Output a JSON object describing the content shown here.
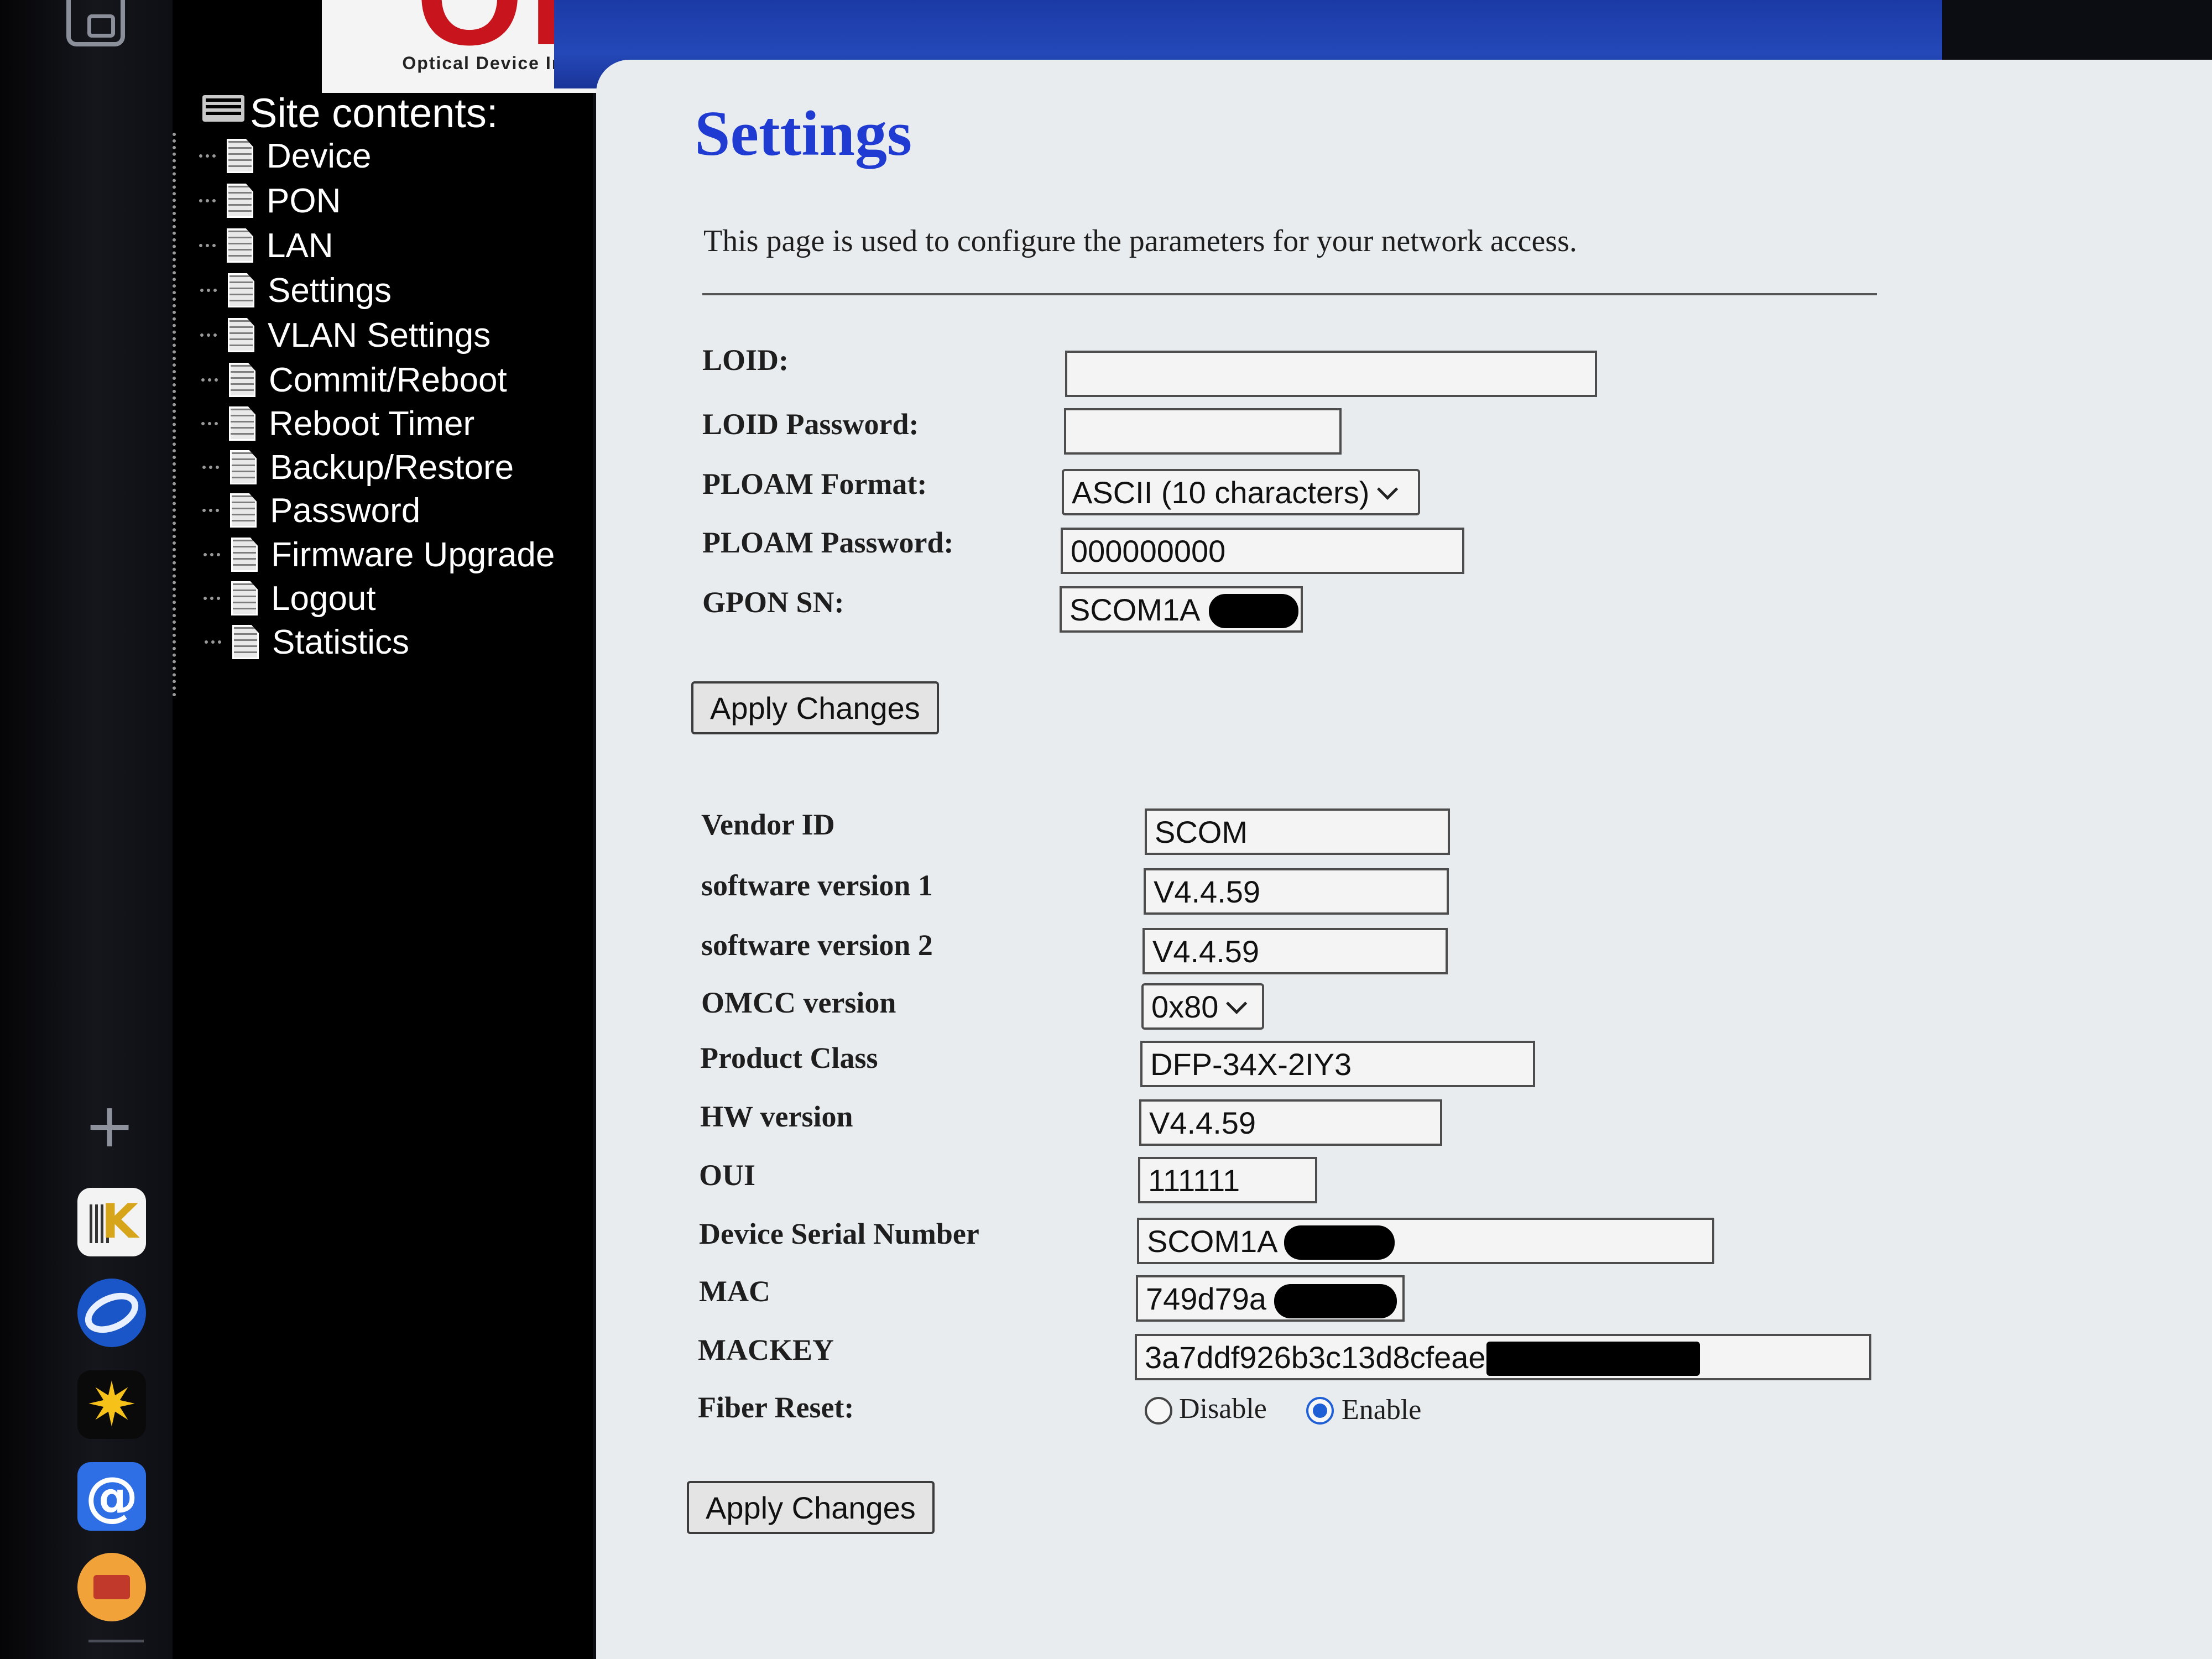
{
  "logo": {
    "tagline": "Optical Device Innovation"
  },
  "nav": {
    "title": "Site contents:",
    "items": [
      {
        "label": "Device"
      },
      {
        "label": "PON"
      },
      {
        "label": "LAN"
      },
      {
        "label": "Settings"
      },
      {
        "label": "VLAN Settings"
      },
      {
        "label": "Commit/Reboot"
      },
      {
        "label": "Reboot Timer"
      },
      {
        "label": "Backup/Restore"
      },
      {
        "label": "Password"
      },
      {
        "label": "Firmware Upgrade"
      },
      {
        "label": "Logout"
      },
      {
        "label": "Statistics"
      }
    ]
  },
  "page": {
    "title": "Settings",
    "description": "This page is used to configure the parameters for your network access."
  },
  "pon_form": {
    "loid_label": "LOID:",
    "loid_value": "",
    "loid_password_label": "LOID Password:",
    "loid_password_value": "",
    "ploam_format_label": "PLOAM Format:",
    "ploam_format_value": "ASCII (10 characters)",
    "ploam_password_label": "PLOAM Password:",
    "ploam_password_value": "000000000",
    "gpon_sn_label": "GPON SN:",
    "gpon_sn_value": "SCOM1A",
    "apply_label": "Apply Changes"
  },
  "omci_form": {
    "vendor_id_label": "Vendor ID",
    "vendor_id_value": "SCOM",
    "sw_version1_label": "software version 1",
    "sw_version1_value": "V4.4.59",
    "sw_version2_label": "software version 2",
    "sw_version2_value": "V4.4.59",
    "omcc_version_label": "OMCC version",
    "omcc_version_value": "0x80",
    "product_class_label": "Product Class",
    "product_class_value": "DFP-34X-2IY3",
    "hw_version_label": "HW version",
    "hw_version_value": "V4.4.59",
    "oui_label": "OUI",
    "oui_value": "111111",
    "device_sn_label": "Device Serial Number",
    "device_sn_value": "SCOM1A",
    "mac_label": "MAC",
    "mac_value": "749d79a",
    "mackey_label": "MACKEY",
    "mackey_value": "3a7ddf926b3c13d8cfeaeb",
    "fiber_reset_label": "Fiber Reset:",
    "fiber_reset_disable": "Disable",
    "fiber_reset_enable": "Enable",
    "fiber_reset_selected": "Enable",
    "apply_label": "Apply Changes"
  },
  "colors": {
    "title_blue": "#1f3bd1",
    "banner_blue": "#1b3aa6",
    "nav_bg": "#000000",
    "content_bg": "#e9ecef"
  }
}
